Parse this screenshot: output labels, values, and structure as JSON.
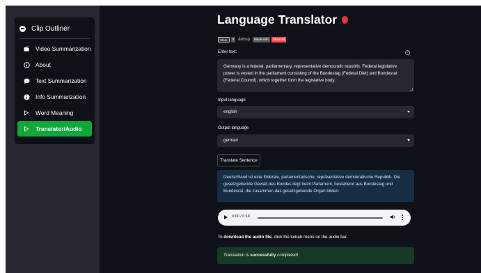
{
  "sidebar": {
    "title": "Clip Outliner",
    "items": [
      {
        "label": "Video Summarization",
        "icon": "clapper-icon"
      },
      {
        "label": "About",
        "icon": "info-circle-icon"
      },
      {
        "label": "Text Summarization",
        "icon": "chat-bubble-icon"
      },
      {
        "label": "Info Summarization",
        "icon": "info-filled-icon"
      },
      {
        "label": "Word Meaning",
        "icon": "play-outline-icon"
      },
      {
        "label": "Translator/Audio",
        "icon": "play-outline-icon",
        "active": true
      }
    ],
    "active_color": "#11a83a"
  },
  "main": {
    "title": "Language Translator",
    "badges": {
      "github": "Stars",
      "count": "0",
      "amp": "&nbsp",
      "made_with": "Made with",
      "streamlit": "Streamlit"
    },
    "enter_text_label": "Enter text:",
    "input_text": "Germany is a federal, parliamentary, representative democratic republic. Federal legislative power is vested in the parliament consisting of the Bundestag (Federal Diet) and Bundesrat (Federal Council), which together form the legislative body.",
    "input_language_label": "Input language",
    "input_language_value": "english",
    "output_language_label": "Output language",
    "output_language_value": "german",
    "translate_button": "Translate Sentence",
    "translated_text": "Deutschland ist eine föderale, parlamentarische, repräsentative demokratische Republik. Die gesetzgebende Gewalt des Bundes liegt beim Parlament, bestehend aus Bundestag und Bundesrat, die zusammen das gesetzgebende Organ bilden.",
    "audio": {
      "time": "0:00 / 0:18",
      "progress": 0
    },
    "download_note": {
      "prefix": "To ",
      "bold": "download the audio file",
      "suffix": ", click the kebab menu on the audio bar."
    },
    "success": {
      "prefix": "Translation is ",
      "bold": "successfully",
      "suffix": " completed!"
    }
  }
}
